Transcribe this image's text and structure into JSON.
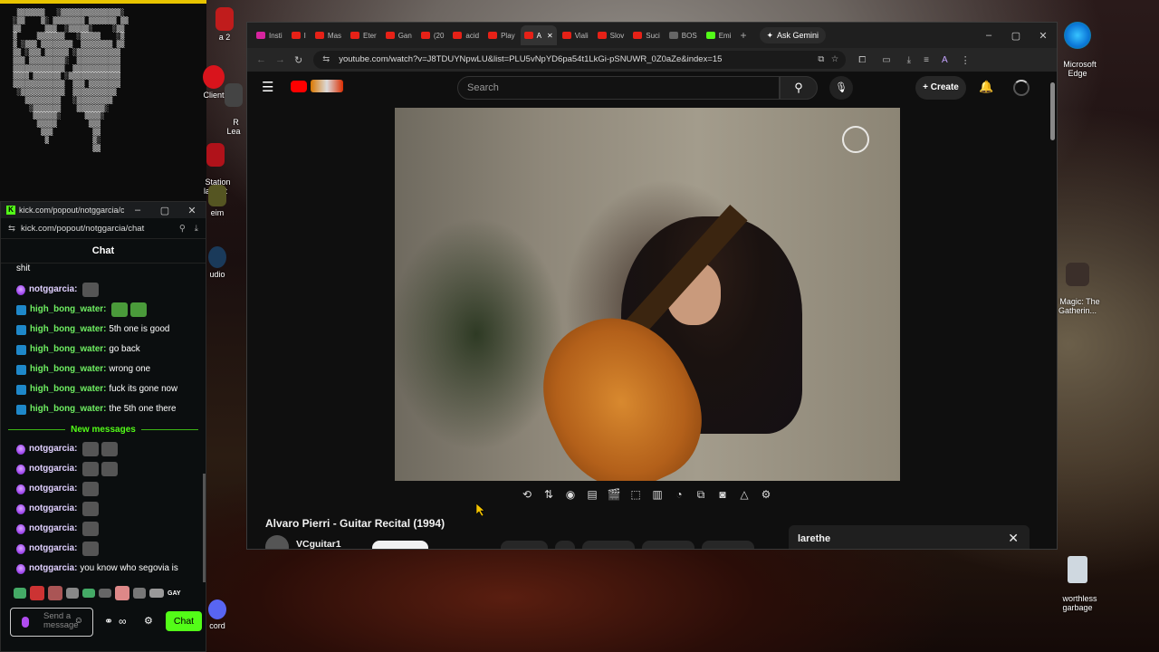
{
  "ascii_art": "  ▒▒▒▒▒▒▒   ░▒▒▒▒▒▒▒▒▒▒▒▒▒▒▒░\n ░▒▒    ▒░ ▒▒▒▒▒▒▒▒ ▒▒▒▒▒▒▒ ▒▒\n ▒▒      ▒▒▒  ░▒▒▒▒▒░     ░▒▒\n ▒     ▒▒▒▒▒▒▒   ░▒▒▒▒▒    ░▒\n ▒ ░▒▒▒ ▒▒▒▒▒▒▒▒  ▒▒▒▒▒▒▒▒ ▒▒\n ▒▒ ░▒▒▒ ▒▒▒▒▒▒ ░▒▒▒▒▒▒▒▒▒▒▒\n ▒▒▒ ▒▒▒▒▒▒▒▒▒░  ▒▒▒▒▒▒▒▒▒▒▒\n ▒▒▒▒▒▒▒▒▒▒▒▒▒  ▒▒▒▒▒▒▒▒▒▒▒▒\n ▒▒▒▒ ▒▒▒▒▒▒▒ ░▒▒▒▒▒▒▒▒▒▒▒▒▒\n ▒▒▒▒▒▒▒▒▒▒▒▒▒  ▒▒▒ ▒▒▒▒▒▒▒▒\n  ░▒▒▒▒▒▒▒▒▒▒▒  ▒▒▒▒▒▒▒▒▒▒▒\n    ▒▒▒▒▒▒▒▒▒   ░▒▒▒▒▒▒▒▒▒\n     ░▒▒▒▒▒▒▒    ▒▒▒▒▒▒▒░\n      ▒▒▒▒▒▒░      ▒▒▒▒░\n       ▒▒▒▒▒        ▒▒▒\n        ▒▒▒          ▒▒\n         ▒           ▒░\n                     ▒▒",
  "desktop_icons": {
    "left_top": "a 2",
    "client": "Client",
    "reader": "R\nLea",
    "station": "Station\nlaytest",
    "steam": "eim",
    "studio": "udio",
    "cord": "cord",
    "edge": "Microsoft\nEdge",
    "magic": "Magic: The\nGatherin...",
    "recycle": "worthless\ngarbage"
  },
  "kick": {
    "window_title": "kick.com/popout/notggarcia/c...",
    "url": "kick.com/popout/notggarcia/chat",
    "chat_header": "Chat",
    "first_line": "shit",
    "new_messages_label": "New messages",
    "messages_before": [
      {
        "user": "notggarcia:",
        "text": "",
        "type": "ng",
        "emotes": 1
      },
      {
        "user": "high_bong_water:",
        "text": "",
        "type": "hb",
        "emotes": 2
      },
      {
        "user": "high_bong_water:",
        "text": "5th one is good",
        "type": "hb",
        "emotes": 0
      },
      {
        "user": "high_bong_water:",
        "text": "go back",
        "type": "hb",
        "emotes": 0
      },
      {
        "user": "high_bong_water:",
        "text": "wrong one",
        "type": "hb",
        "emotes": 0
      },
      {
        "user": "high_bong_water:",
        "text": "fuck its gone now",
        "type": "hb",
        "emotes": 0
      },
      {
        "user": "high_bong_water:",
        "text": "the 5th one there",
        "type": "hb",
        "emotes": 0
      }
    ],
    "messages_after": [
      {
        "user": "notggarcia:",
        "text": "",
        "type": "ng",
        "emotes": 2
      },
      {
        "user": "notggarcia:",
        "text": "",
        "type": "ng",
        "emotes": 2
      },
      {
        "user": "notggarcia:",
        "text": "",
        "type": "ng",
        "emotes": 1
      },
      {
        "user": "notggarcia:",
        "text": "",
        "type": "ng",
        "emotes": 1
      },
      {
        "user": "notggarcia:",
        "text": "",
        "type": "ng",
        "emotes": 1
      },
      {
        "user": "notggarcia:",
        "text": "",
        "type": "ng",
        "emotes": 1
      },
      {
        "user": "notggarcia:",
        "text": "you know who segovia is",
        "type": "ng",
        "emotes": 0
      }
    ],
    "gay_label": "GAY",
    "input_placeholder": "Send a message",
    "chat_button": "Chat"
  },
  "browser": {
    "tabs": [
      "Insti",
      "I",
      "Mas",
      "Eter",
      "Gan",
      "(20",
      "acid",
      "Play",
      "A",
      "Viali",
      "Slov",
      "Suci",
      "BOS",
      "Emi"
    ],
    "active_tab_index": 8,
    "gemini_label": "Ask Gemini",
    "url": "youtube.com/watch?v=J8TDUYNpwLU&list=PLU5vNpYD6pa54t1LkGi-pSNUWR_0Z0aZe&index=15",
    "search_placeholder": "Search",
    "create_label": "Create",
    "video_title": "Alvaro Pierri - Guitar Recital (1994)",
    "channel": "VCguitar1",
    "side_panel_title": "larethe"
  },
  "colors": {
    "kick_green": "#53fc18",
    "youtube_red": "#ff0000"
  }
}
